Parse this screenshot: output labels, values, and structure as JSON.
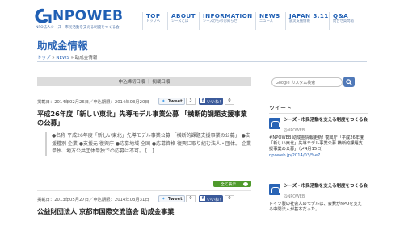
{
  "header": {
    "logo_text": "NPOWEB",
    "logo_subtitle": "NPO法人シーズ・市民活動を支える制度をつくる会",
    "nav": [
      {
        "en": "TOP",
        "jp": "トップへ"
      },
      {
        "en": "ABOUT",
        "jp": "シーズとは"
      },
      {
        "en": "INFORMATION",
        "jp": "シーズからのお知らせ"
      },
      {
        "en": "NEWS",
        "jp": "ニュース"
      },
      {
        "en": "JAPAN 3.11",
        "jp": "震災支援情報"
      },
      {
        "en": "Q&A",
        "jp": "問合せ質問箱"
      }
    ]
  },
  "page": {
    "title": "助成金情報",
    "breadcrumb": {
      "home": "トップ",
      "sep1": " » ",
      "news": "NEWS",
      "sep2": " » ",
      "current": "助成金情報"
    }
  },
  "sort_bar": {
    "label": "申込締切日順 ｜ 掲載日順"
  },
  "search": {
    "placeholder": "Google カスタム検索"
  },
  "posts": [
    {
      "meta": "掲載日：2014年02月26日／申込期限：2014年03月20日",
      "tweet_label": "Tweet",
      "tweet_count": "3",
      "like_label": "いいね！",
      "like_count": "0",
      "title": "平成26年度「新しい東北」先導モデル事業公募 「横断的課題支援事業の公募」",
      "excerpt": "●名称 平成26年度「新しい東北」先導モデル事業公募 「横断的課題支援事業の公募」 ●支援種別 企業 ●支援元 復興庁 ●応募地域 全国 ●応募資格 復興に取り組む法人・団体。 企業単独、地方公共団体単独での応募は不可。 […]",
      "more_label": "全て表示"
    },
    {
      "meta": "掲載日：2013年05月27日／申込期限：2014年03月31日",
      "tweet_label": "Tweet",
      "tweet_count": "0",
      "like_label": "いいね！",
      "like_count": "0",
      "title": "公益財団法人 京都市国際交流協会 助成金事業"
    }
  ],
  "tweets": {
    "heading": "ツイート",
    "items": [
      {
        "name": "シーズ・市民活動を支える制度をつくる会",
        "handle": "@NPOWEB",
        "body": "#NPOWEB 助成金情報更新! 復興庁「平成26年度「新しい東北」先導モデル事業公募 横断的課題支援事業の公募」（〆4月15日）",
        "link": "npoweb.jp/2014/03/%e7..."
      },
      {
        "name": "シーズ・市民活動を支える制度をつくる会",
        "handle": "@NPOWEB",
        "body": "ドイツ製の社会人のモデルは、会費がNPOを支える中間法人が基本だった。",
        "link": ""
      }
    ]
  }
}
